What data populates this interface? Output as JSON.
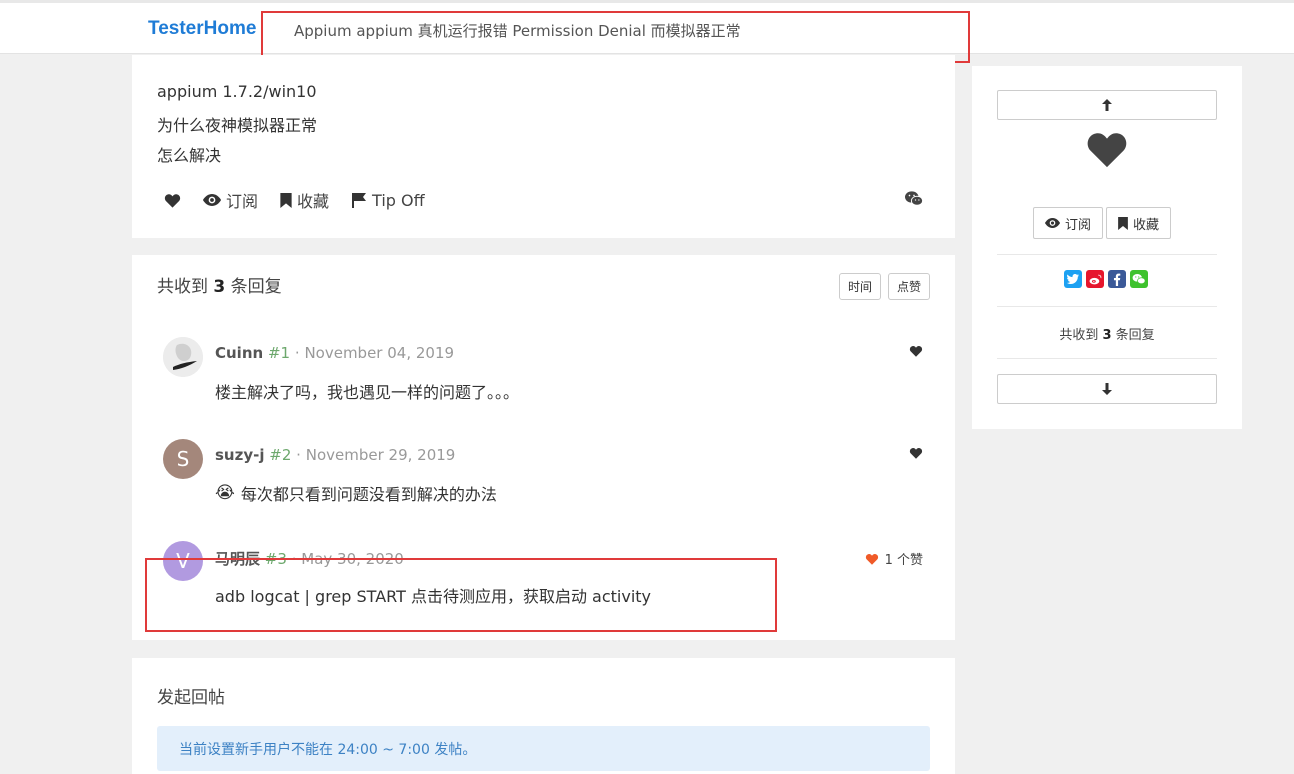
{
  "brand": "TesterHome",
  "topic_title": "Appium  appium 真机运行报错 Permission Denial 而模拟器正常",
  "post": {
    "lines": [
      "appium 1.7.2/win10",
      "为什么夜神模拟器正常",
      "怎么解决"
    ],
    "actions": {
      "subscribe": "订阅",
      "favorite": "收藏",
      "tipoff": "Tip Off"
    }
  },
  "replies": {
    "header_prefix": "共收到",
    "count": "3",
    "header_suffix": "条回复",
    "sort": [
      "时间",
      "点赞"
    ],
    "items": [
      {
        "user": "Cuinn",
        "floor": "#1",
        "date": "November 04, 2019",
        "body": "楼主解决了吗，我也遇见一样的问题了。。。",
        "likes": ""
      },
      {
        "user": "suzy-j",
        "floor": "#2",
        "date": "November 29, 2019",
        "body": "每次都只看到问题没看到解决的办法",
        "emoji": "😭",
        "avatar_letter": "S",
        "likes": ""
      },
      {
        "user": "马明辰",
        "floor": "#3",
        "date": "May 30, 2020",
        "body": "adb logcat | grep START 点击待测应用，获取启动 activity",
        "avatar_letter": "V",
        "likes": "1 个赞"
      }
    ]
  },
  "new_post": {
    "title": "发起回帖",
    "notice": "当前设置新手用户不能在 24:00 ~ 7:00 发帖。"
  },
  "sidebar": {
    "subscribe": "订阅",
    "favorite": "收藏",
    "count_prefix": "共收到",
    "count": "3",
    "count_suffix": "条回复"
  },
  "colors": {
    "brand": "#1f7cd6",
    "highlight_border": "#e03a3a",
    "liked_heart": "#f05a28",
    "notice_bg": "#e3effb"
  }
}
